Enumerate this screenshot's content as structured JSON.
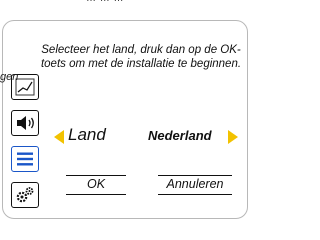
{
  "header": {
    "partial_text": "… … …"
  },
  "side": {
    "partial_label": "gen"
  },
  "dialog": {
    "instruction": "Selecteer het land, druk dan op de OK-toets om met de installatie te beginnen.",
    "land_label": "Land",
    "land_value": "Nederland",
    "ok_label": "OK",
    "cancel_label": "Annuleren"
  },
  "icons": {
    "sidebar": [
      "chart-icon",
      "speaker-icon",
      "menu-icon",
      "settings-icon"
    ],
    "arrows": [
      "arrow-left-icon",
      "arrow-right-icon"
    ]
  },
  "colors": {
    "arrow": "#f2c200",
    "menu_icon": "#1a56c8",
    "frame_border": "#b8b8b8"
  }
}
